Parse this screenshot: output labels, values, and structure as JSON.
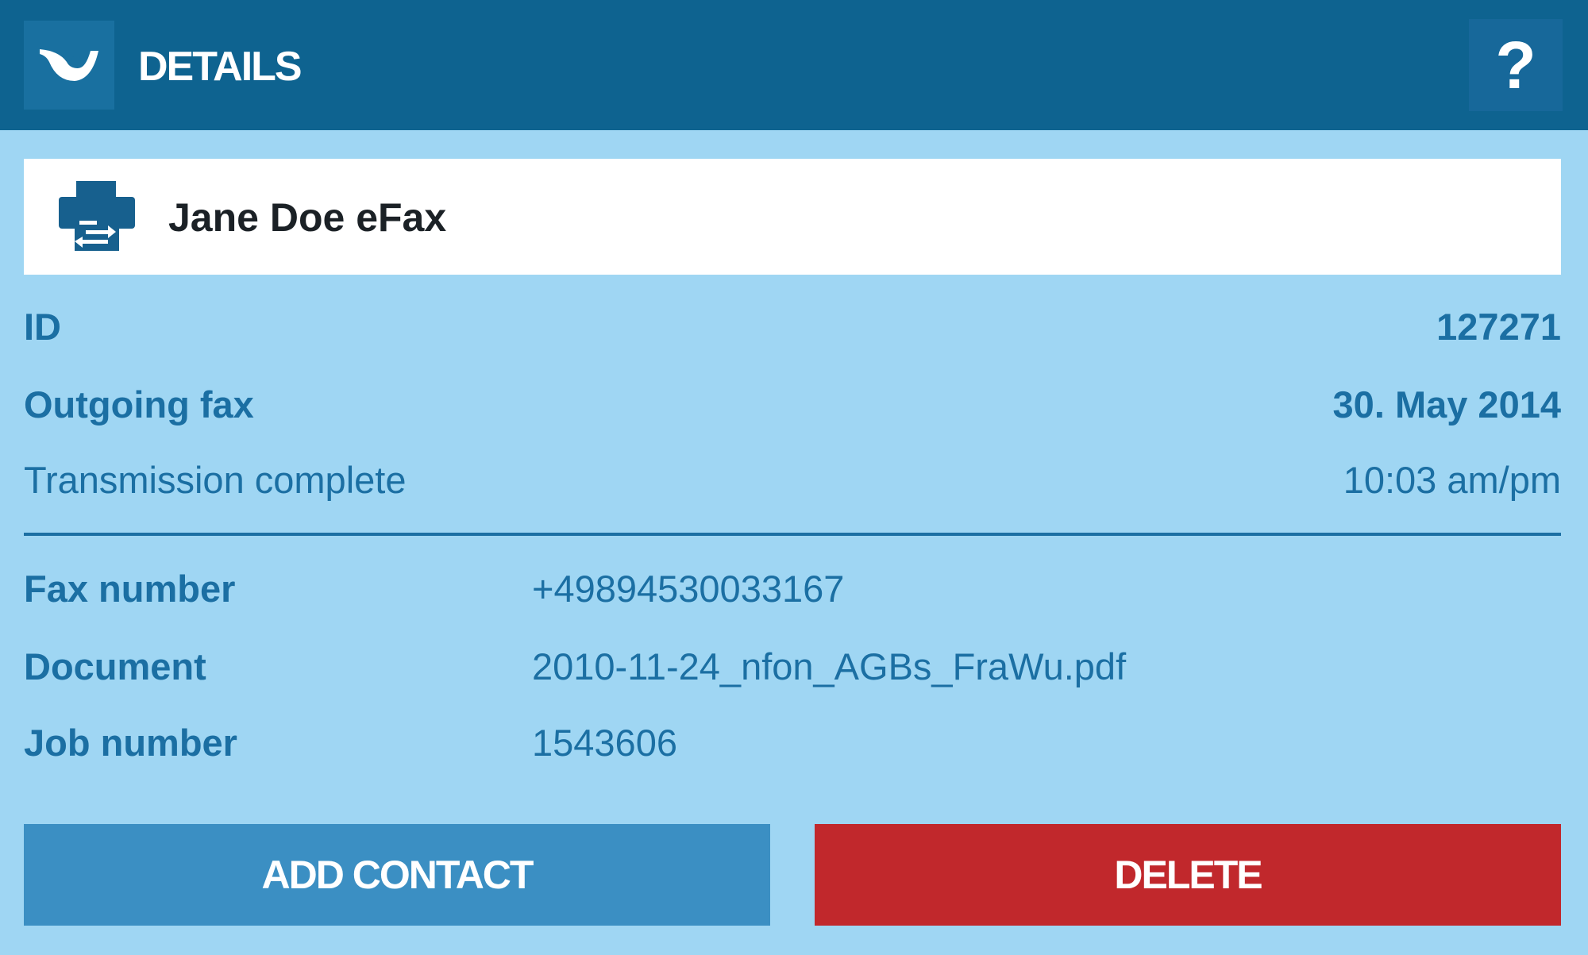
{
  "header": {
    "title": "DETAILS",
    "help_label": "?"
  },
  "contact": {
    "name": "Jane Doe eFax",
    "icon": "fax-icon"
  },
  "summary": {
    "id_label": "ID",
    "id_value": "127271",
    "direction_label": "Outgoing fax",
    "date_value": "30. May 2014",
    "status_label": "Transmission complete",
    "time_value": "10:03 am/pm"
  },
  "details": {
    "fax_number_label": "Fax number",
    "fax_number_value": "+49894530033167",
    "document_label": "Document",
    "document_value": "2010-11-24_nfon_AGBs_FraWu.pdf",
    "job_number_label": "Job number",
    "job_number_value": "1543606"
  },
  "actions": {
    "add_contact_label": "ADD CONTACT",
    "delete_label": "DELETE"
  },
  "colors": {
    "header_bg": "#0e6390",
    "panel_bg": "#9fd6f3",
    "text_blue": "#1b6fa3",
    "add_button": "#3b8fc3",
    "delete_button": "#c1282c"
  }
}
